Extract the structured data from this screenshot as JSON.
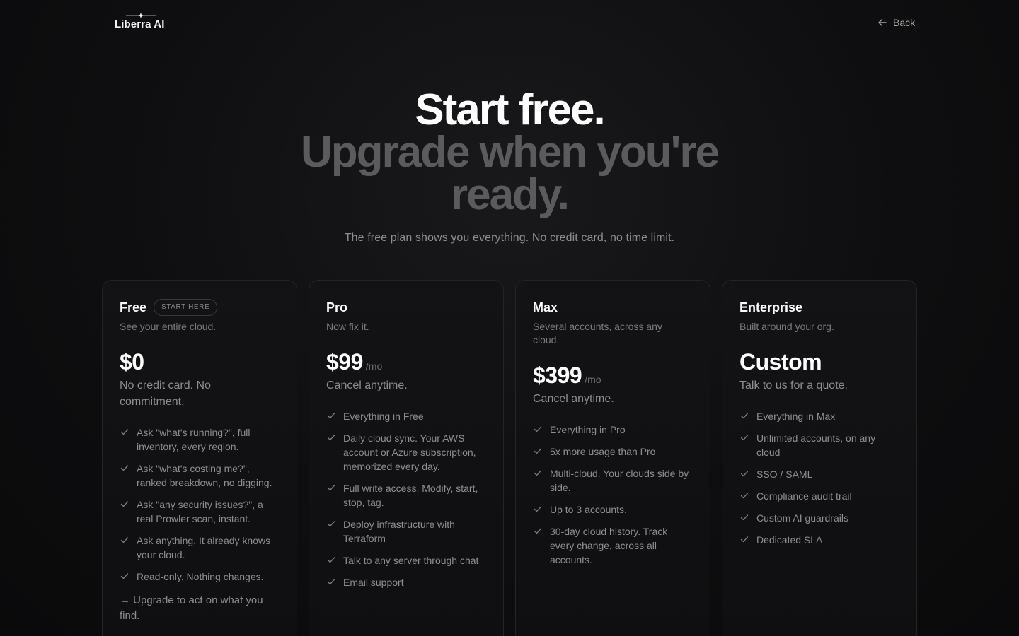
{
  "brand": {
    "name": "Liberra AI"
  },
  "nav": {
    "back_label": "Back"
  },
  "hero": {
    "title_line1": "Start free.",
    "title_line2": "Upgrade when you're ready.",
    "subtitle": "The free plan shows you everything. No credit card, no time limit."
  },
  "plans": [
    {
      "name": "Free",
      "badge": "START HERE",
      "description": "See your entire cloud.",
      "price": "$0",
      "period": "",
      "price_note": "No credit card. No commitment.",
      "features": [
        "Ask \"what's running?\", full inventory, every region.",
        "Ask \"what's costing me?\", ranked breakdown, no digging.",
        "Ask \"any security issues?\", a real Prowler scan, instant.",
        "Ask anything. It already knows your cloud.",
        "Read-only. Nothing changes."
      ],
      "footer_note": "→ Upgrade to act on what you find."
    },
    {
      "name": "Pro",
      "description": "Now fix it.",
      "price": "$99",
      "period": "/mo",
      "price_note": "Cancel anytime.",
      "features": [
        "Everything in Free",
        "Daily cloud sync. Your AWS account or Azure subscription, memorized every day.",
        "Full write access. Modify, start, stop, tag.",
        "Deploy infrastructure with Terraform",
        "Talk to any server through chat",
        "Email support"
      ]
    },
    {
      "name": "Max",
      "description": "Several accounts, across any cloud.",
      "price": "$399",
      "period": "/mo",
      "price_note": "Cancel anytime.",
      "features": [
        "Everything in Pro",
        "5x more usage than Pro",
        "Multi-cloud. Your clouds side by side.",
        "Up to 3 accounts.",
        "30-day cloud history. Track every change, across all accounts."
      ]
    },
    {
      "name": "Enterprise",
      "description": "Built around your org.",
      "price": "Custom",
      "period": "",
      "price_note": "Talk to us for a quote.",
      "features": [
        "Everything in Max",
        "Unlimited accounts, on any cloud",
        "SSO / SAML",
        "Compliance audit trail",
        "Custom AI guardrails",
        "Dedicated SLA"
      ]
    }
  ]
}
